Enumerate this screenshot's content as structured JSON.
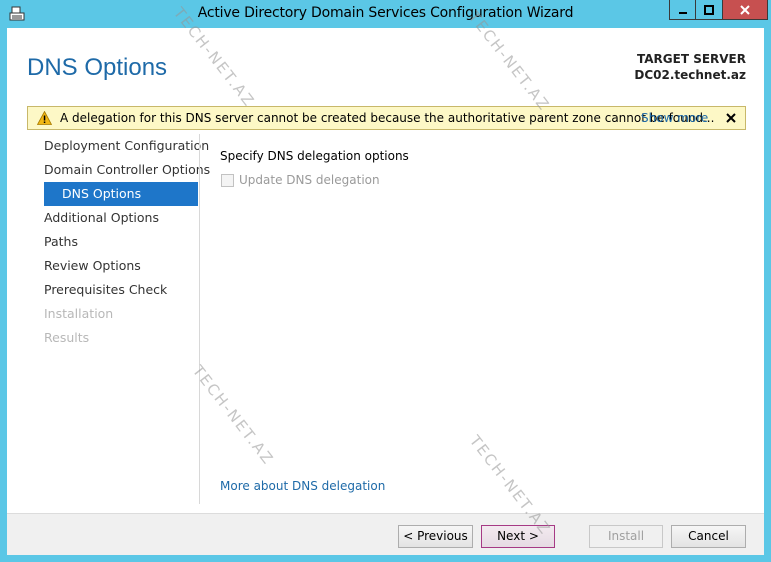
{
  "window": {
    "title": "Active Directory Domain Services Configuration Wizard"
  },
  "page": {
    "heading": "DNS Options",
    "target_server_label": "TARGET SERVER",
    "target_server_value": "DC02.technet.az"
  },
  "warning": {
    "text": "A delegation for this DNS server cannot be created because the authoritative parent zone cannot be found...",
    "show_more": "Show more"
  },
  "nav": {
    "items": [
      {
        "label": "Deployment Configuration",
        "state": "normal"
      },
      {
        "label": "Domain Controller Options",
        "state": "normal"
      },
      {
        "label": "DNS Options",
        "state": "active"
      },
      {
        "label": "Additional Options",
        "state": "normal"
      },
      {
        "label": "Paths",
        "state": "normal"
      },
      {
        "label": "Review Options",
        "state": "normal"
      },
      {
        "label": "Prerequisites Check",
        "state": "normal"
      },
      {
        "label": "Installation",
        "state": "disabled"
      },
      {
        "label": "Results",
        "state": "disabled"
      }
    ]
  },
  "content": {
    "heading": "Specify DNS delegation options",
    "checkbox_label": "Update DNS delegation",
    "checkbox_checked": false,
    "more_link": "More about DNS delegation"
  },
  "footer": {
    "previous": "< Previous",
    "next": "Next >",
    "install": "Install",
    "cancel": "Cancel"
  },
  "watermark": {
    "text": "TECH-NET.AZ"
  },
  "colors": {
    "titlebar": "#5bc7e6",
    "heading": "#1e6aa8",
    "nav_active": "#1e76c9",
    "warning_bg": "#fdf8c6",
    "close_button": "#c75050"
  }
}
